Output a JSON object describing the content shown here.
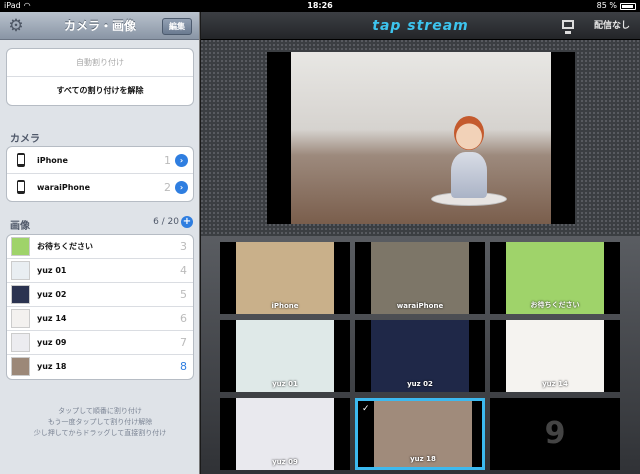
{
  "status": {
    "device": "iPad",
    "time": "18:26",
    "battery": "85 %"
  },
  "left": {
    "title": "カメラ・画像",
    "edit_label": "編集",
    "actions": {
      "auto_assign": "自動割り付け",
      "clear_all": "すべての割り付けを解除"
    },
    "camera_section": "カメラ",
    "cameras": [
      {
        "name": "iPhone",
        "num": "1"
      },
      {
        "name": "waraiPhone",
        "num": "2"
      }
    ],
    "image_section": "画像",
    "image_count": "6 / 20",
    "images": [
      {
        "name": "お待ちください",
        "num": "3",
        "color": "#9fd36a"
      },
      {
        "name": "yuz 01",
        "num": "4",
        "color": "#e9eef2"
      },
      {
        "name": "yuz 02",
        "num": "5",
        "color": "#2b3350"
      },
      {
        "name": "yuz 14",
        "num": "6",
        "color": "#f3f1ef"
      },
      {
        "name": "yuz 09",
        "num": "7",
        "color": "#ececf0"
      },
      {
        "name": "yuz 18",
        "num": "8",
        "color": "#9c8878"
      }
    ],
    "hint": [
      "タップして順番に割り付け",
      "もう一度タップして割り付け解除",
      "少し押してからドラッグして直接割り付け"
    ]
  },
  "right": {
    "logo": "tap stream",
    "delivery_label": "配信なし",
    "cells": [
      {
        "caption": "iPhone",
        "color": "#c9b08a"
      },
      {
        "caption": "waraiPhone",
        "color": "#7d7668"
      },
      {
        "caption": "お待ちください",
        "color": "#9fd36a"
      },
      {
        "caption": "yuz 01",
        "color": "#dfe9e8"
      },
      {
        "caption": "yuz 02",
        "color": "#1f2848"
      },
      {
        "caption": "yuz 14",
        "color": "#f5f3f0"
      },
      {
        "caption": "yuz 09",
        "color": "#e9e9ee"
      },
      {
        "caption": "yuz 18",
        "color": "#a08b7b"
      },
      {
        "caption": "9",
        "color": "#000000"
      }
    ]
  }
}
